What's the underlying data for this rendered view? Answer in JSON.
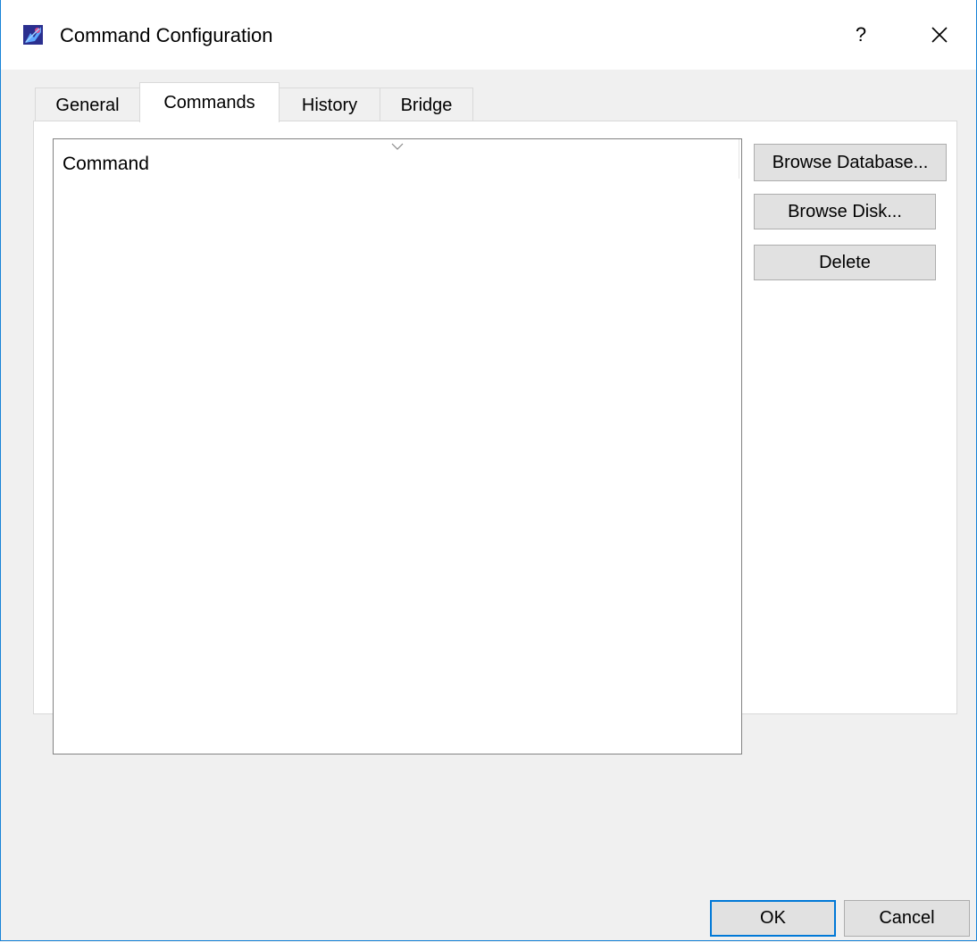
{
  "window": {
    "title": "Command Configuration",
    "help_label": "?",
    "close_label": "×"
  },
  "tabs": [
    {
      "label": "General",
      "active": false
    },
    {
      "label": "Commands",
      "active": true
    },
    {
      "label": "History",
      "active": false
    },
    {
      "label": "Bridge",
      "active": false
    }
  ],
  "commands_list": {
    "column_header": "Command",
    "rows": []
  },
  "side_buttons": {
    "browse_database": "Browse Database...",
    "browse_disk": "Browse Disk...",
    "delete": "Delete"
  },
  "footer": {
    "ok": "OK",
    "cancel": "Cancel"
  },
  "colors": {
    "accent": "#0078d7",
    "window_border": "#1883d7",
    "background": "#f0f0f0"
  }
}
